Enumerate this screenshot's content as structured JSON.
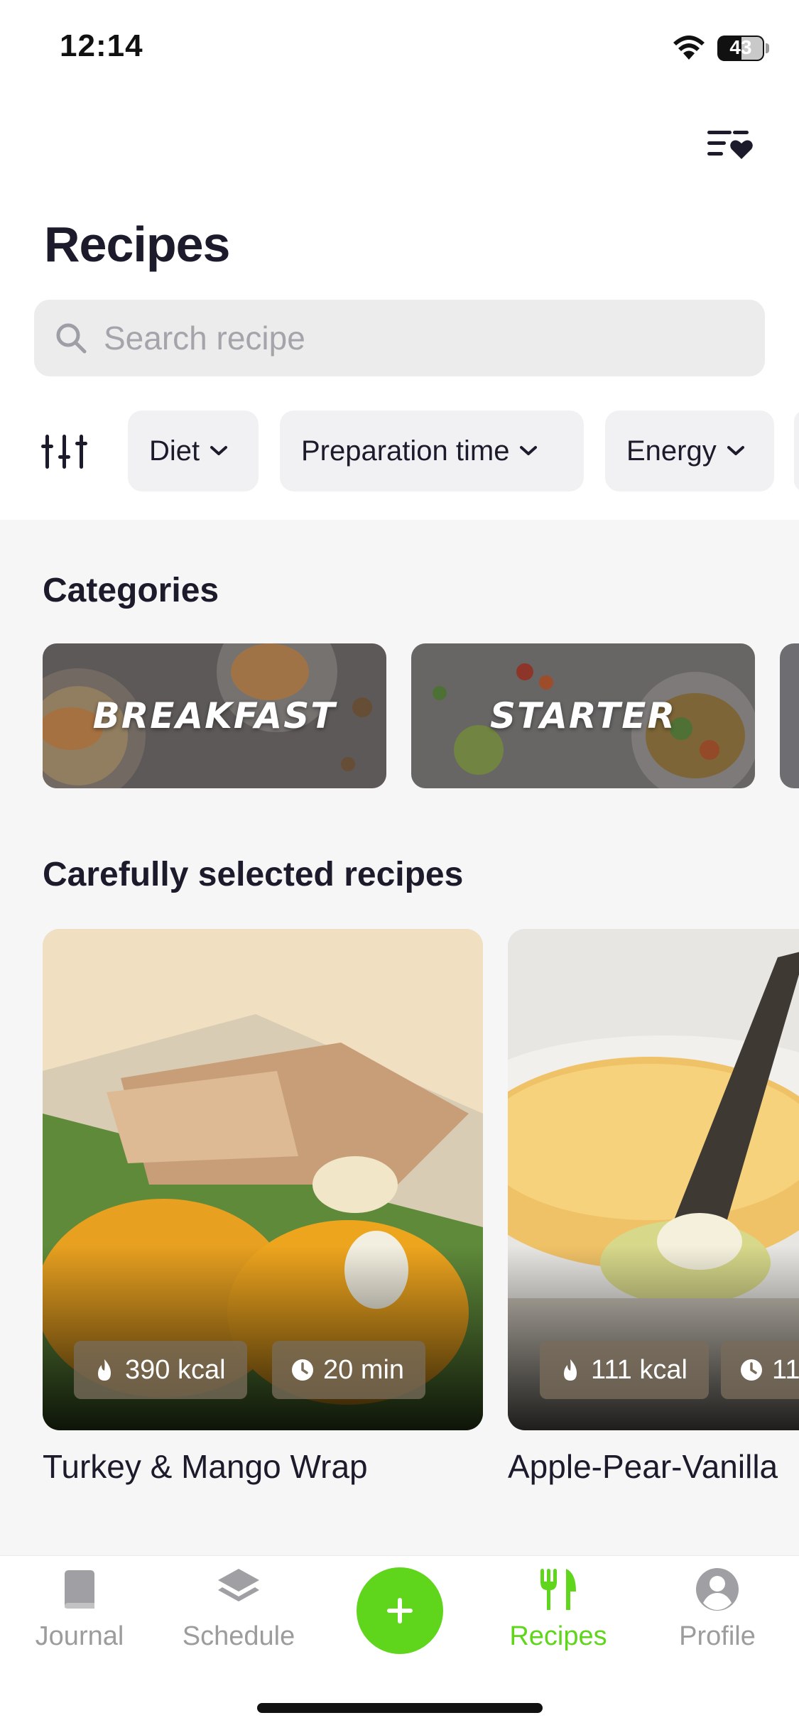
{
  "status_bar": {
    "time": "12:14",
    "battery": "43",
    "icons": [
      "wifi-icon",
      "battery-icon"
    ]
  },
  "header": {
    "favorites_icon": "list-heart-icon",
    "title": "Recipes"
  },
  "search": {
    "placeholder": "Search recipe",
    "value": "",
    "icon": "search-icon"
  },
  "filters": {
    "icon": "sliders-icon",
    "chips": [
      {
        "label": "Diet"
      },
      {
        "label": "Preparation time"
      },
      {
        "label": "Energy"
      }
    ]
  },
  "categories": {
    "title": "Categories",
    "items": [
      {
        "label": "BREAKFAST"
      },
      {
        "label": "STARTER"
      }
    ]
  },
  "selected": {
    "title": "Carefully selected recipes",
    "recipes": [
      {
        "name": "Turkey & Mango Wrap",
        "kcal": "390 kcal",
        "time": "20 min"
      },
      {
        "name": "Apple-Pear-Vanilla",
        "kcal": "111 kcal",
        "time": "11"
      }
    ]
  },
  "tab_bar": {
    "tabs": [
      {
        "label": "Journal",
        "icon": "book-icon"
      },
      {
        "label": "Schedule",
        "icon": "layers-icon"
      },
      {
        "label": "Recipes",
        "icon": "fork-knife-icon",
        "active": true
      },
      {
        "label": "Profile",
        "icon": "user-icon"
      }
    ],
    "add_icon": "plus-icon"
  },
  "colors": {
    "accent": "#5fd61b",
    "text": "#1b1b2b",
    "muted": "#9c9c9c",
    "surface": "#f6f6f7"
  }
}
